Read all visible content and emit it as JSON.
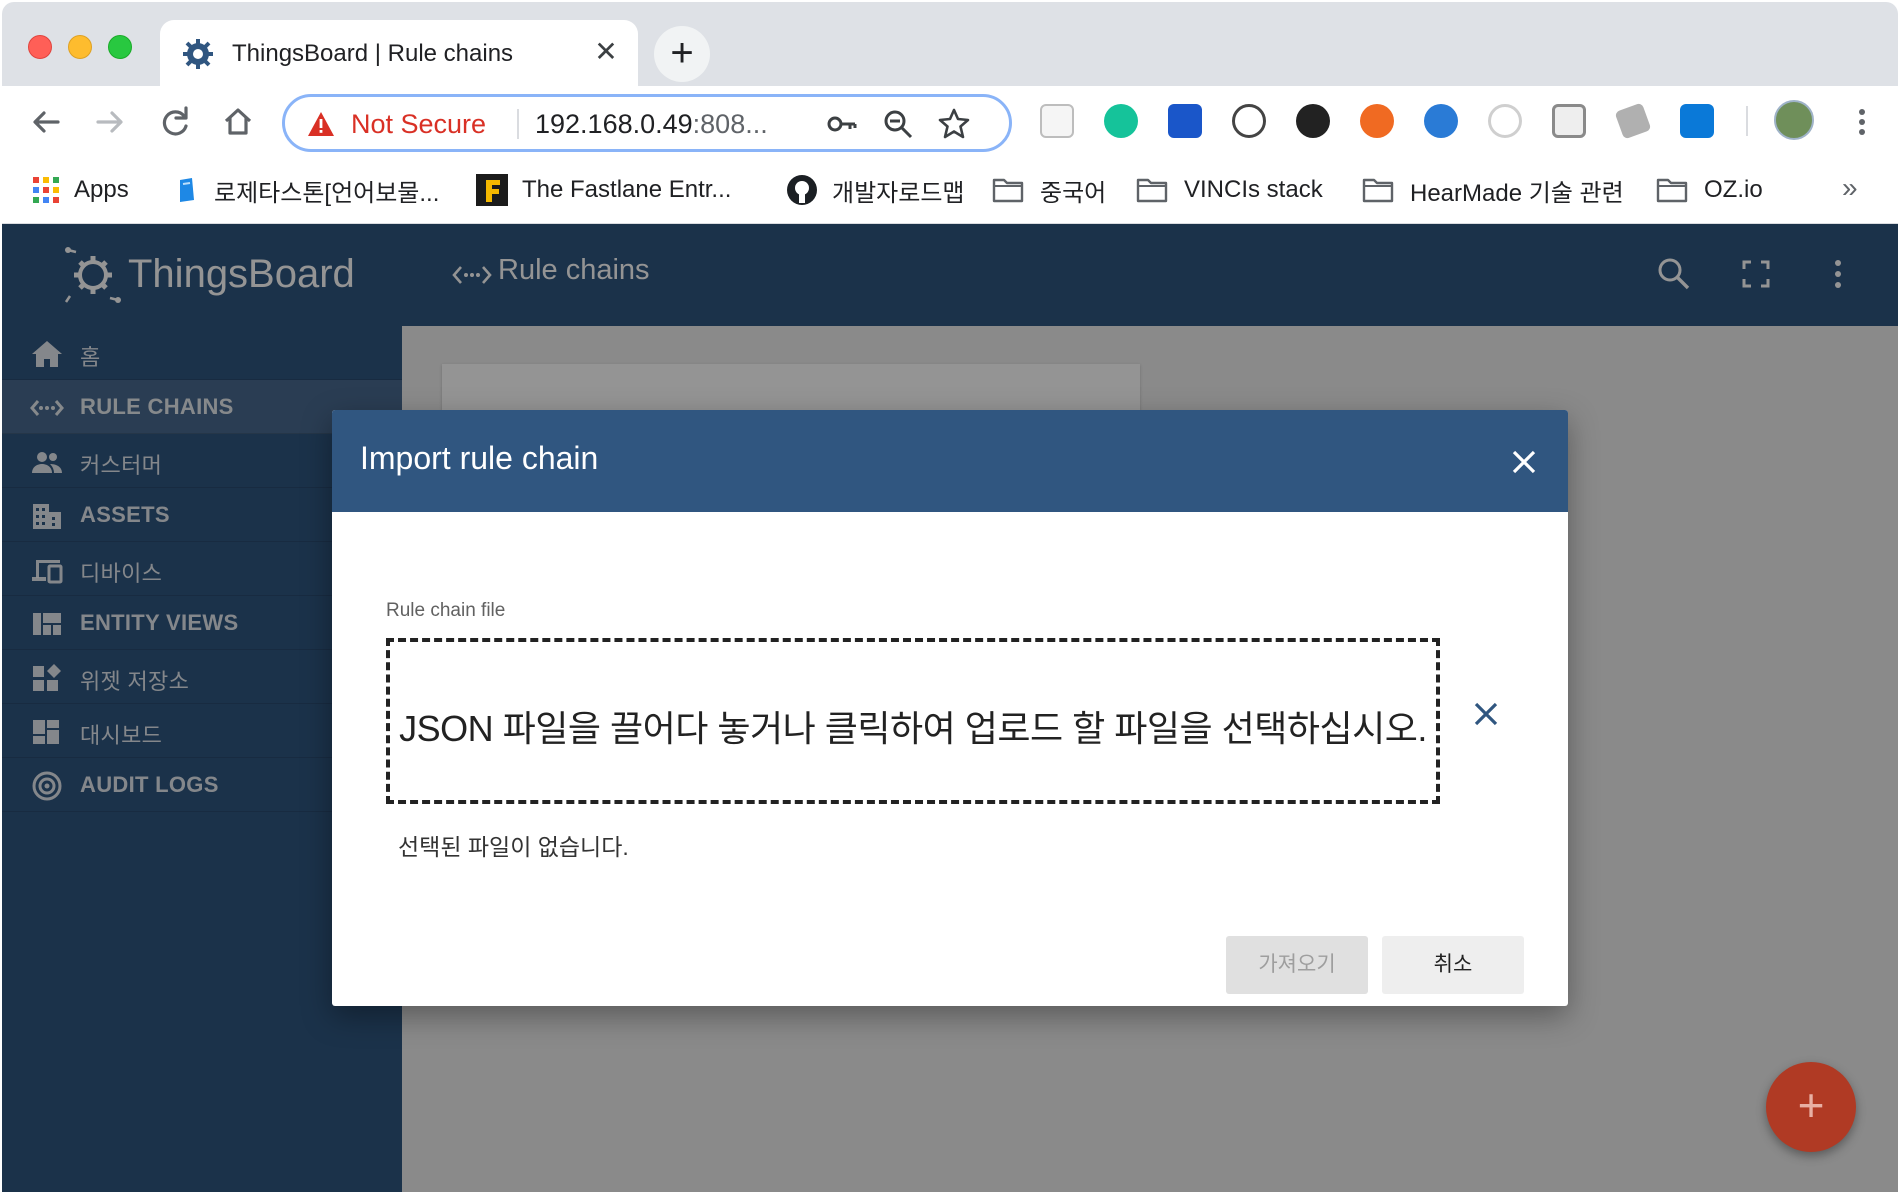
{
  "browser": {
    "tab_title": "ThingsBoard | Rule chains",
    "tab_close": "✕",
    "new_tab": "+",
    "security_label": "Not Secure",
    "url_host": "192.168.0.49",
    "url_rest": ":808...",
    "bookmarks": [
      {
        "label": "Apps"
      },
      {
        "label": "로제타스톤[언어보물..."
      },
      {
        "label": "The Fastlane Entr..."
      },
      {
        "label": "개발자로드맵"
      },
      {
        "label": "중국어"
      },
      {
        "label": "VINCIs stack"
      },
      {
        "label": "HearMade 기술 관련"
      },
      {
        "label": "OZ.io"
      }
    ],
    "bookmarks_more": "»"
  },
  "app": {
    "logo_text": "ThingsBoard",
    "page_title": "Rule chains",
    "menu": [
      {
        "label": "홈",
        "icon": "home-icon"
      },
      {
        "label": "RULE CHAINS",
        "icon": "rule-chains-icon"
      },
      {
        "label": "커스터머",
        "icon": "customers-icon"
      },
      {
        "label": "ASSETS",
        "icon": "assets-icon"
      },
      {
        "label": "디바이스",
        "icon": "devices-icon"
      },
      {
        "label": "ENTITY VIEWS",
        "icon": "entity-views-icon"
      },
      {
        "label": "위젯 저장소",
        "icon": "widgets-icon"
      },
      {
        "label": "대시보드",
        "icon": "dashboards-icon"
      },
      {
        "label": "AUDIT LOGS",
        "icon": "audit-logs-icon"
      }
    ],
    "fab_label": "+"
  },
  "dialog": {
    "title": "Import rule chain",
    "field_label": "Rule chain file",
    "dropzone_text": "JSON 파일을 끌어다 놓거나 클릭하여 업로드 할 파일을 선택하십시오.",
    "no_file_text": "선택된 파일이 없습니다.",
    "import_button": "가져오기",
    "cancel_button": "취소"
  },
  "colors": {
    "primary": "#305680",
    "accent": "#b03a24",
    "not_secure": "#d93025"
  }
}
